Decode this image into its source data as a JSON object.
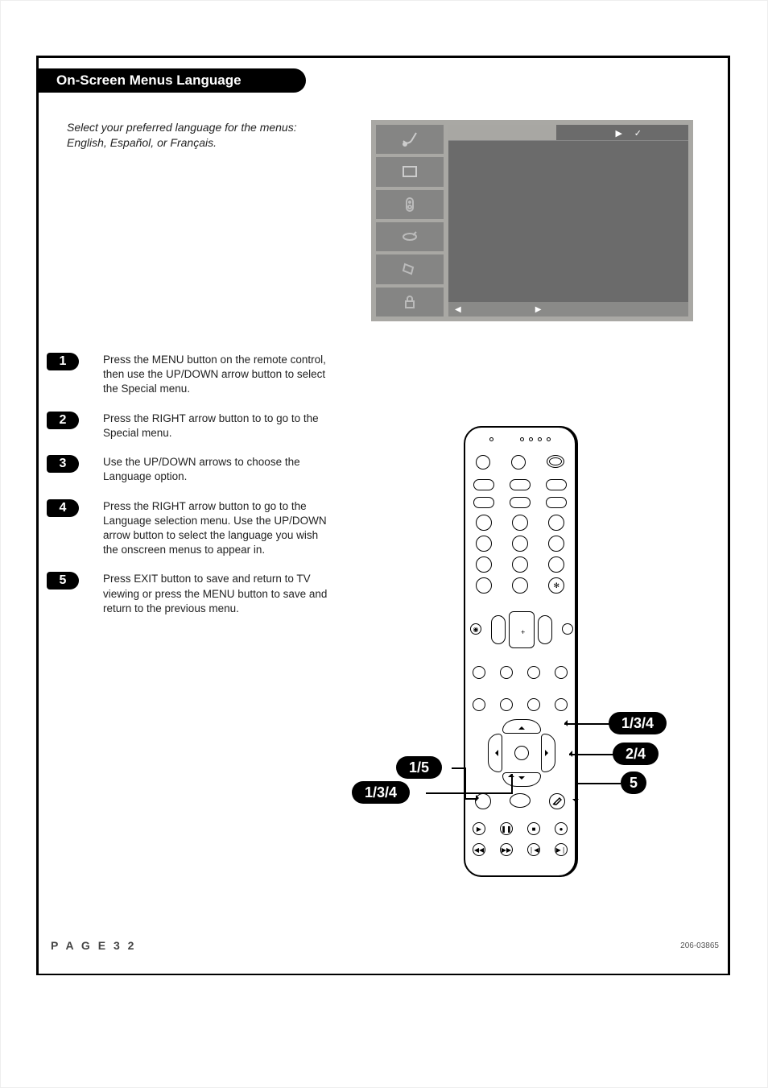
{
  "title": "On-Screen Menus Language",
  "intro": "Select your preferred language for the menus: English, Español, or Français.",
  "steps": [
    {
      "num": "1",
      "text": "Press the MENU button on the remote control, then use the UP/DOWN arrow button to select the Special menu."
    },
    {
      "num": "2",
      "text": "Press the RIGHT arrow button to to go to the Special menu."
    },
    {
      "num": "3",
      "text": "Use the UP/DOWN arrows to choose the Language option."
    },
    {
      "num": "4",
      "text": "Press the RIGHT arrow button to go to the Language selection menu. Use the UP/DOWN arrow button to select the language you wish the onscreen menus to appear in."
    },
    {
      "num": "5",
      "text": "Press EXIT button to save and return to TV viewing or press the MENU button to save and return to the previous menu."
    }
  ],
  "callouts": {
    "left_menu": "1/5",
    "left_down": "1/3/4",
    "right_up": "1/3/4",
    "right_mid": "2/4",
    "right_exit": "5"
  },
  "footer": "P A G E  3 2",
  "doc_num": "206-03865",
  "osd": {
    "tabs": [
      "satellite",
      "screen",
      "speaker",
      "brush",
      "tag",
      "lock"
    ],
    "top_indicators": [
      "▶",
      "✓"
    ],
    "bottom_indicators": [
      "◀",
      "▶"
    ]
  }
}
